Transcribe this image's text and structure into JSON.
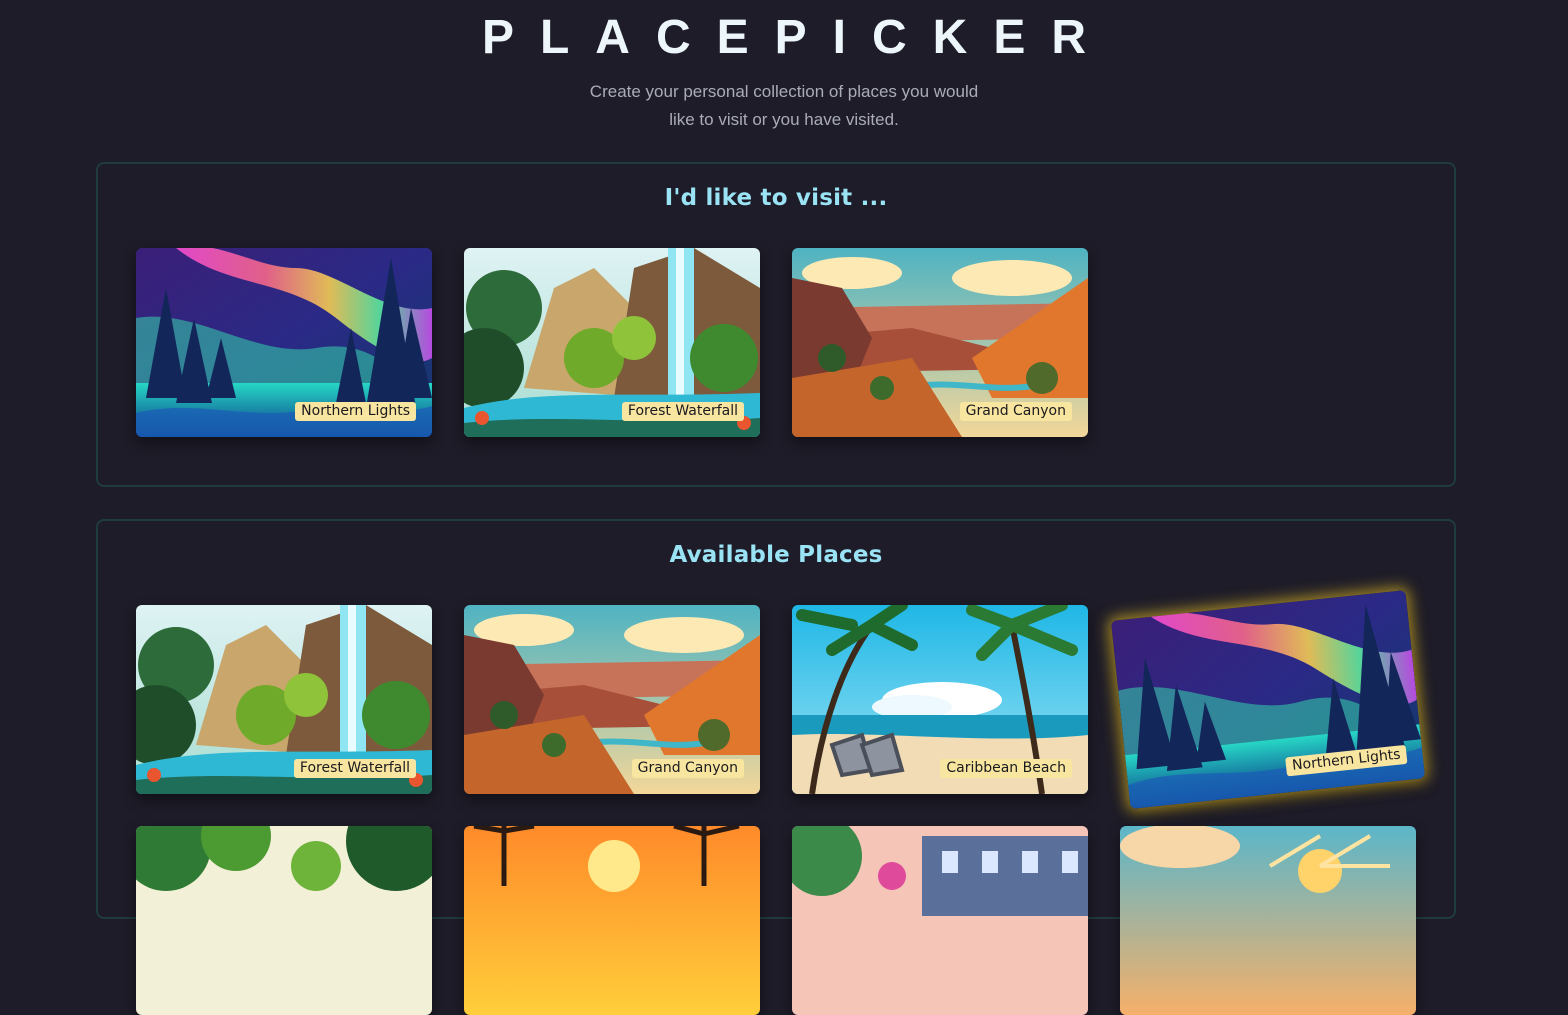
{
  "header": {
    "title": "PLACEPICKER",
    "subtitle": "Create your personal collection of places you would like to visit or you have visited."
  },
  "visit_section": {
    "title": "I'd like to visit ...",
    "places": [
      {
        "label": "Northern Lights",
        "image": "aurora"
      },
      {
        "label": "Forest Waterfall",
        "image": "waterfall"
      },
      {
        "label": "Grand Canyon",
        "image": "canyon"
      }
    ]
  },
  "available_section": {
    "title": "Available Places",
    "places": [
      {
        "label": "Forest Waterfall",
        "image": "waterfall"
      },
      {
        "label": "Grand Canyon",
        "image": "canyon"
      },
      {
        "label": "Caribbean Beach",
        "image": "beach"
      },
      {
        "label": "Northern Lights",
        "image": "aurora",
        "highlighted": true
      },
      {
        "label": "",
        "image": "jungle"
      },
      {
        "label": "",
        "image": "sunset-palms"
      },
      {
        "label": "",
        "image": "city-street"
      },
      {
        "label": "",
        "image": "mountain-sunset"
      }
    ]
  },
  "colors": {
    "background": "#1e1c28",
    "section_title": "#9ae3f5",
    "label_bg": "#f8e6a0",
    "highlight_glow": "#e6be28"
  }
}
